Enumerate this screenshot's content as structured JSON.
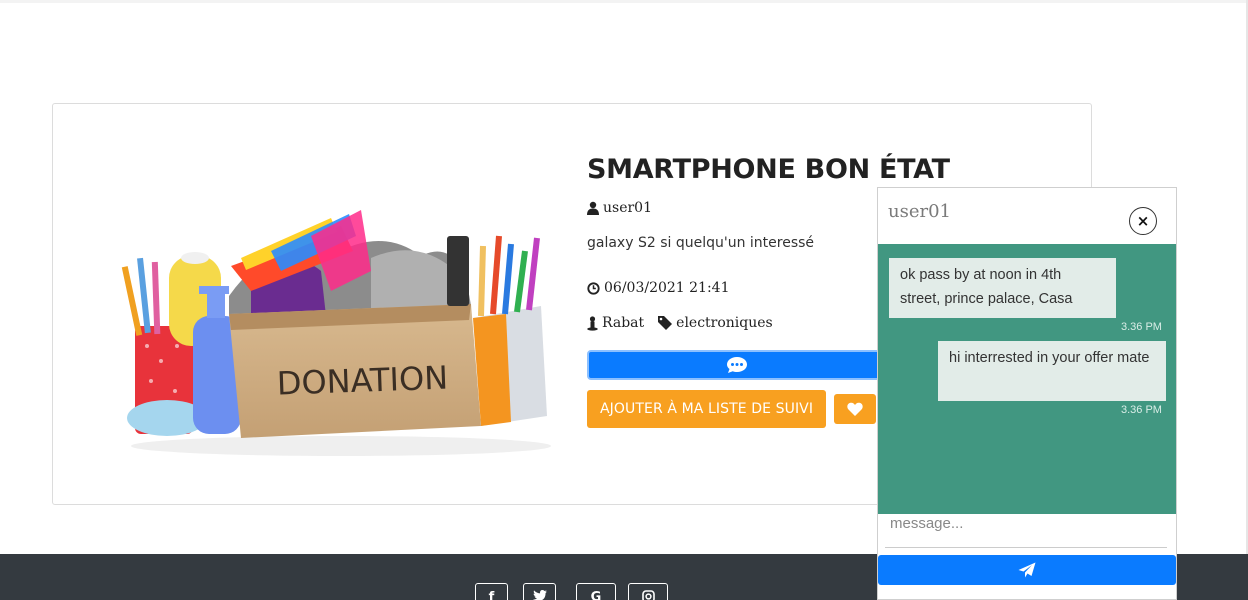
{
  "product": {
    "title": "SMARTPHONE BON ÉTAT",
    "user": "user01",
    "description": "galaxy S2 si quelqu'un interessé",
    "datetime": "06/03/2021 21:41",
    "city": "Rabat",
    "category": "electroniques",
    "image_label": "DONATION",
    "follow_label": "AJOUTER À MA LISTE DE SUIVI"
  },
  "icons": {
    "user": "user-icon",
    "clock": "clock-icon",
    "location": "map-marker-icon",
    "tag": "tag-icon",
    "message": "chat-bubble-icon",
    "heart": "heart-icon",
    "send": "paper-plane-icon",
    "close": "close-icon"
  },
  "chat": {
    "username": "user01",
    "close_symbol": "×",
    "messages": [
      {
        "text": "ok pass by at noon in 4th street, prince palace, Casa",
        "time": "3.36 PM",
        "side": "left"
      },
      {
        "text": "hi interrested in your offer mate",
        "time": "3.36 PM",
        "side": "right"
      }
    ],
    "placeholder": "message..."
  },
  "footer": {
    "social": [
      "f",
      "t",
      "G",
      "ig"
    ]
  },
  "colors": {
    "primary": "#0a7bff",
    "orange": "#f8a020",
    "chat_green": "#419781",
    "footer": "#343a40"
  }
}
